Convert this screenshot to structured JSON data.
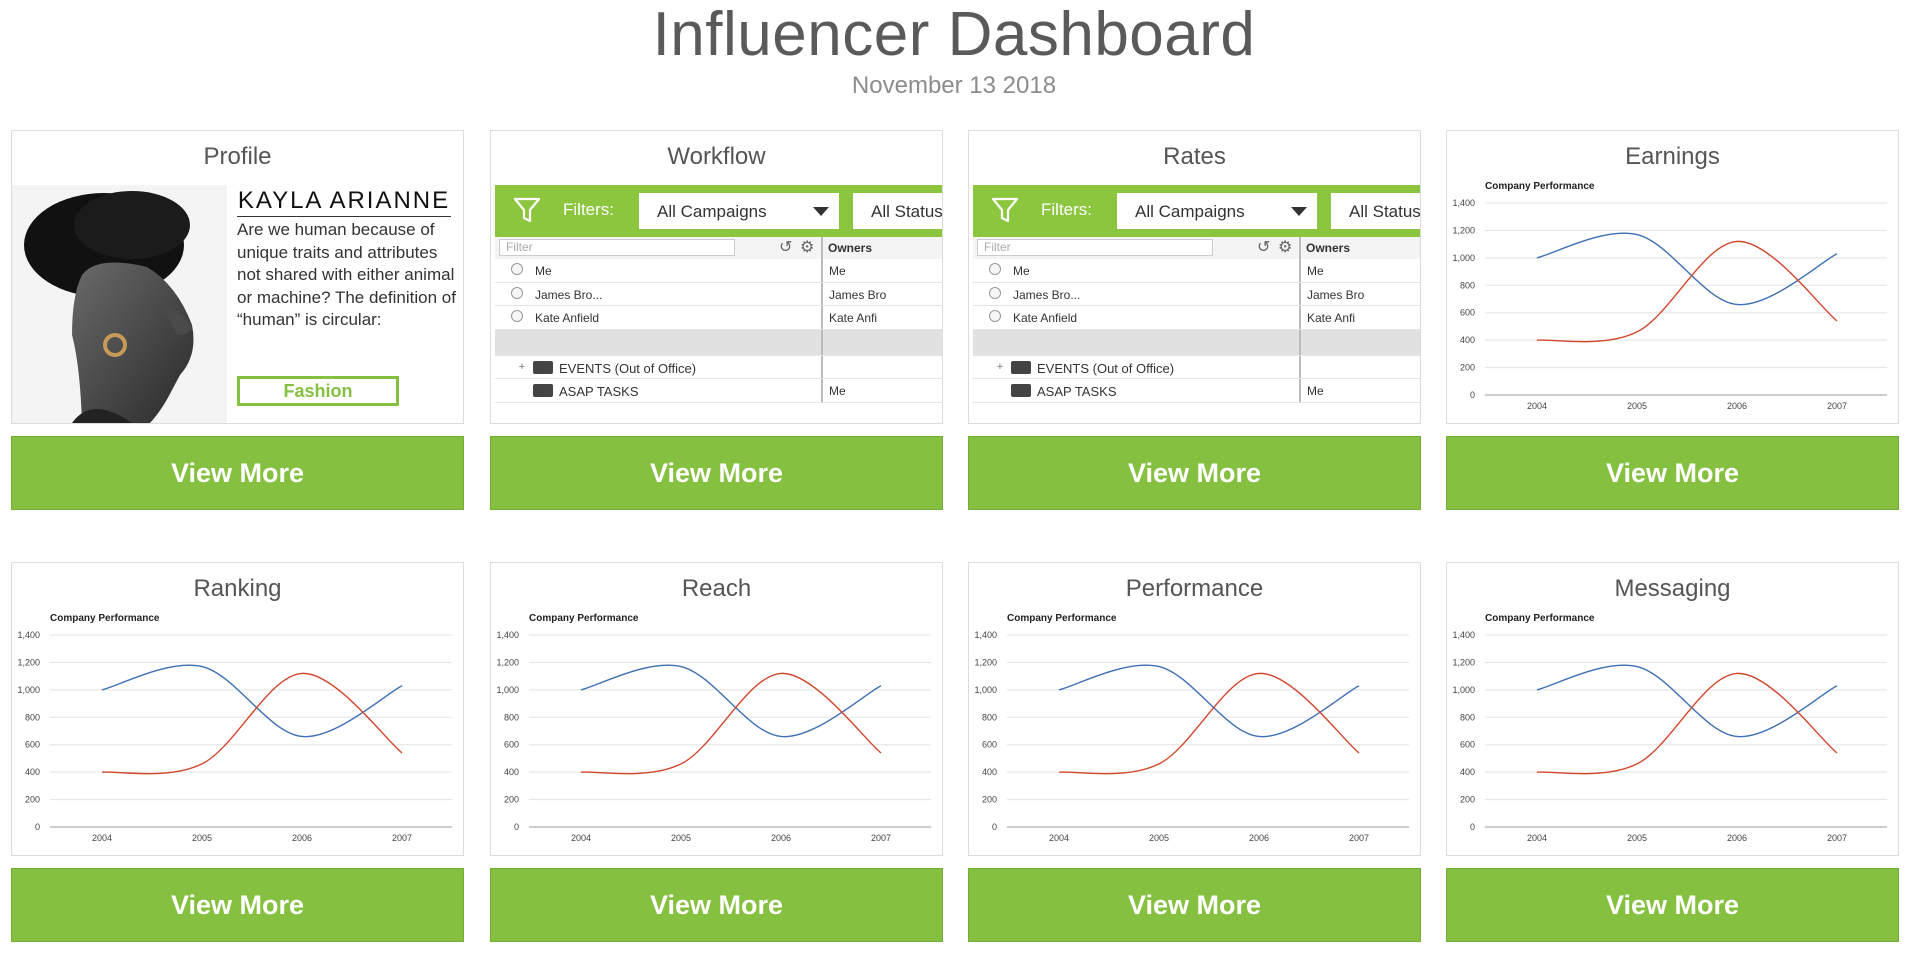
{
  "header": {
    "title": "Influencer Dashboard",
    "date": "November 13 2018"
  },
  "view_more_label": "View More",
  "accent_color": "#86c041",
  "profile": {
    "title": "Profile",
    "name": "KAYLA   ARIANNE",
    "bio": "Are we human because of unique traits and attributes not shared with either animal or machine? The definition of “human” is circular:",
    "tag": "Fashion"
  },
  "workflow": {
    "title": "Workflow",
    "filters_label": "Filters:",
    "campaign_select": "All Campaigns",
    "status_select": "All Status",
    "filter_placeholder": "Filter",
    "owners_header": "Owners",
    "rows": [
      {
        "name": "Me",
        "owner": "Me"
      },
      {
        "name": "James Bro...",
        "owner": "James Bro"
      },
      {
        "name": "Kate Anfield",
        "owner": "Kate Anfi"
      }
    ],
    "events_label": "EVENTS (Out of Office)",
    "tasks_label": "ASAP TASKS",
    "tasks_owner": "Me"
  },
  "rates": {
    "title": "Rates",
    "filters_label": "Filters:",
    "campaign_select": "All Campaigns",
    "status_select": "All Status",
    "filter_placeholder": "Filter",
    "owners_header": "Owners",
    "rows": [
      {
        "name": "Me",
        "owner": "Me"
      },
      {
        "name": "James Bro...",
        "owner": "James Bro"
      },
      {
        "name": "Kate Anfield",
        "owner": "Kate Anfi"
      }
    ],
    "events_label": "EVENTS (Out of Office)",
    "tasks_label": "ASAP TASKS",
    "tasks_owner": "Me"
  },
  "chart_cards": [
    {
      "id": "earnings",
      "title": "Earnings"
    },
    {
      "id": "ranking",
      "title": "Ranking"
    },
    {
      "id": "reach",
      "title": "Reach"
    },
    {
      "id": "performance",
      "title": "Performance"
    },
    {
      "id": "messaging",
      "title": "Messaging"
    }
  ],
  "chart_data": {
    "type": "line",
    "title": "Company Performance",
    "categories": [
      "2004",
      "2005",
      "2006",
      "2007"
    ],
    "ylim": [
      0,
      1400
    ],
    "yticks": [
      "0",
      "200",
      "400",
      "600",
      "800",
      "1,000",
      "1,200",
      "1,400"
    ],
    "grid": true,
    "series": [
      {
        "color": "#3f6fb5",
        "values": [
          1000,
          1170,
          660,
          1030
        ]
      },
      {
        "color": "#d2452c",
        "values": [
          400,
          460,
          1120,
          540
        ]
      }
    ]
  }
}
